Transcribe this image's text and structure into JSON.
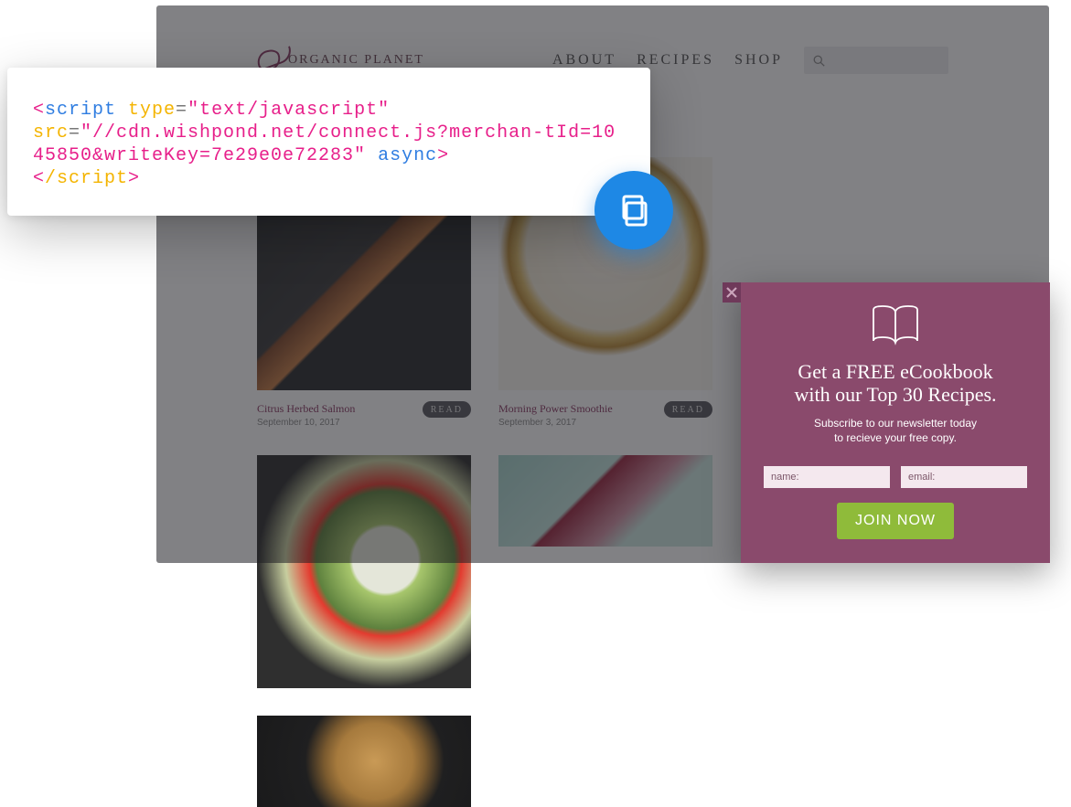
{
  "site": {
    "logo_text": "ORGANIC PLANET",
    "nav": [
      "ABOUT",
      "RECIPES",
      "SHOP"
    ]
  },
  "cards": [
    {
      "title": "Citrus Herbed Salmon",
      "date": "September 10, 2017",
      "read": "READ"
    },
    {
      "title": "Morning Power Smoothie",
      "date": "September 3, 2017",
      "read": "READ"
    },
    {
      "title": "",
      "date": "",
      "read": ""
    },
    {
      "title": "",
      "date": "",
      "read": ""
    },
    {
      "title": "",
      "date": "",
      "read": ""
    }
  ],
  "code": {
    "line1_open": "<",
    "line1_tag": "script ",
    "line1_attr_type": "type",
    "line1_eq": "=",
    "line1_val_type": "\"text/javascript\"",
    "line2_attr_src": "src",
    "line2_val_src": "\"//cdn.wishpond.net/connect.js?merchan-tId=1045850&writeKey=7e29e0e72283\"",
    "line2_async": " async",
    "line2_close": ">",
    "line3_open": "<",
    "line3_slash": "/",
    "line3_tag": "script",
    "line3_close": ">"
  },
  "popup": {
    "title_l1": "Get a FREE eCookbook",
    "title_l2": "with our Top 30 Recipes.",
    "sub_l1": "Subscribe to our newsletter today",
    "sub_l2": "to recieve your free copy.",
    "name_placeholder": "name:",
    "email_placeholder": "email:",
    "cta": "JOIN NOW"
  }
}
